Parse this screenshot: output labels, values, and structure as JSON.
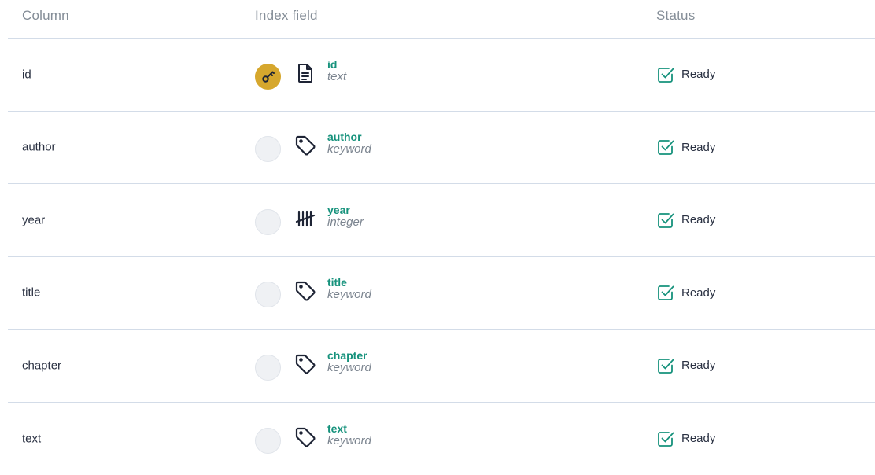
{
  "table": {
    "headers": {
      "column": "Column",
      "index_field": "Index field",
      "status": "Status"
    },
    "rows": [
      {
        "column": "id",
        "field_name": "id",
        "field_type": "text",
        "type_icon": "document-icon",
        "primary_key": true,
        "status": "Ready"
      },
      {
        "column": "author",
        "field_name": "author",
        "field_type": "keyword",
        "type_icon": "tag-icon",
        "primary_key": false,
        "status": "Ready"
      },
      {
        "column": "year",
        "field_name": "year",
        "field_type": "integer",
        "type_icon": "tally-icon",
        "primary_key": false,
        "status": "Ready"
      },
      {
        "column": "title",
        "field_name": "title",
        "field_type": "keyword",
        "type_icon": "tag-icon",
        "primary_key": false,
        "status": "Ready"
      },
      {
        "column": "chapter",
        "field_name": "chapter",
        "field_type": "keyword",
        "type_icon": "tag-icon",
        "primary_key": false,
        "status": "Ready"
      },
      {
        "column": "text",
        "field_name": "text",
        "field_type": "keyword",
        "type_icon": "tag-icon",
        "primary_key": false,
        "status": "Ready"
      }
    ]
  },
  "colors": {
    "accent_green": "#16927c",
    "primary_key_gold": "#d6a72d",
    "divider": "#d3dce8"
  }
}
